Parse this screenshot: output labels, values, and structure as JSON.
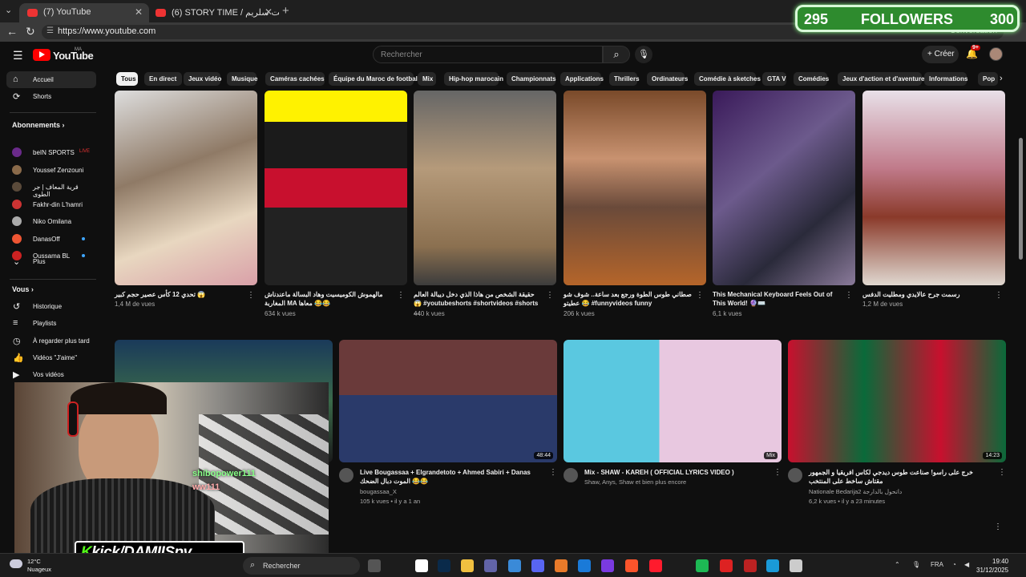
{
  "browser": {
    "tabs": [
      {
        "title": "(7) YouTube"
      },
      {
        "title": "(6) STORY TIME / ماش رجعت سلريم"
      }
    ],
    "url": "https://www.youtube.com",
    "profile_text": "Conversation"
  },
  "overlay": {
    "followers_current": "295",
    "followers_label": "FOLLOWERS",
    "followers_goal": "300",
    "kick_name": "kick/DAMIISpv",
    "kick_k": "K",
    "chat_user": "shibopower111",
    "chat_user2": "ww111"
  },
  "header": {
    "logo": "YouTube",
    "logo_sup": "MA",
    "search_placeholder": "Rechercher",
    "create_label": "Créer",
    "notif_count": "9+"
  },
  "sidebar": {
    "main": [
      {
        "label": "Accueil",
        "icon": "home-icon"
      },
      {
        "label": "Shorts",
        "icon": "shorts-icon"
      }
    ],
    "subs_title": "Abonnements",
    "subs": [
      {
        "label": "beIN SPORTS",
        "color": "#6a2a8a",
        "live": "LIVE"
      },
      {
        "label": "Youssef Zenzouni",
        "color": "#8a6a4a"
      },
      {
        "label": "قرية المعاف | جر الطوى",
        "color": "#5a4a3a"
      },
      {
        "label": "Fakhr-din L'hamri",
        "color": "#c33"
      },
      {
        "label": "Niko Omilana",
        "color": "#aaa"
      },
      {
        "label": "DanasOff",
        "color": "#e53",
        "bullet": true
      },
      {
        "label": "Oussama BL",
        "color": "#c22",
        "bullet": true
      }
    ],
    "more": "Plus",
    "you_title": "Vous",
    "you": [
      {
        "label": "Historique",
        "icon": "history-icon"
      },
      {
        "label": "Playlists",
        "icon": "playlists-icon"
      },
      {
        "label": "À regarder plus tard",
        "icon": "watch-later-icon"
      },
      {
        "label": "Vidéos \"J'aime\"",
        "icon": "like-icon"
      },
      {
        "label": "Vos vidéos",
        "icon": "your-videos-icon"
      }
    ]
  },
  "chips": [
    "Tous",
    "En direct",
    "Jeux vidéo",
    "Musique",
    "Caméras cachées",
    "Équipe du Maroc de football",
    "Mix",
    "Hip-hop marocain",
    "Championnats",
    "Applications",
    "Thrillers",
    "Ordinateurs",
    "Comédie à sketches",
    "GTA V",
    "Comédies",
    "Jeux d'action et d'aventure",
    "Informations",
    "Pop"
  ],
  "shorts": [
    {
      "title": "تحدي 12 كأس عصير حجم كبير 😱",
      "views": "1,4 M de vues"
    },
    {
      "title": "مالهموش الكوميسيت وهاد البسالة ماعندناش المغاربة MA معاها 😂😂",
      "views": "634 k vues"
    },
    {
      "title": "حقيقة الشخص من هاذا الذي دخل ديبالة العالم 😱 #youtubeshorts #shortvideos #shorts ...",
      "views": "440 k vues"
    },
    {
      "title": "صطاني طوس الطوة ورجع بعد ساعة.. شوف شو عطيتو 😂 #funnyvideos funny",
      "views": "206 k vues"
    },
    {
      "title": "This Mechanical Keyboard Feels Out of This World! 🔮⌨️",
      "views": "6,1 k vues"
    },
    {
      "title": "رسمت جرح عالايدي ومطليت الدفس",
      "views": "1,2 M de vues"
    }
  ],
  "videos": [
    {
      "title": "",
      "channel": "",
      "meta": ""
    },
    {
      "title": "Live Bougassaa + Elgrandetoto + Ahmed Sabiri + Danas الموت دبال الضحك 😂😂",
      "channel": "bougassaa_X",
      "meta": "105 k vues • il y a 1 an",
      "duration": "48:44"
    },
    {
      "title": "Mix - SHAW - KAREH ( OFFICIAL LYRICS VIDEO )",
      "channel": "Shaw, Anys, Shaw et bien plus encore",
      "meta": "",
      "duration": "Mix"
    },
    {
      "title": "خرج على راسو! صناعت طوس ديدجي لكاس افريقيا و الجمهور مقتاش ساخط على المنتخب",
      "channel": "Nationale Bedarija2 داتحول بالدارجة",
      "meta": "6,2 k vues • il y a 23 minutes",
      "duration": "14:23"
    }
  ],
  "taskbar": {
    "temp": "12°C",
    "weather": "Nuageux",
    "search": "Rechercher",
    "lang": "FRA",
    "time": "19:40",
    "date": "31/12/2025"
  }
}
